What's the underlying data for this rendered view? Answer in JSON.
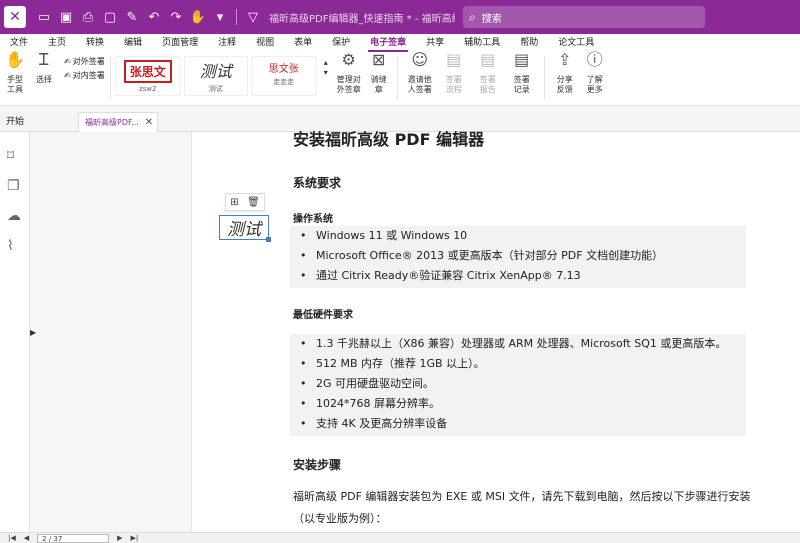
{
  "titlebar": {
    "logo": "✕",
    "doc_title": "福昕高级PDF编辑器_快速指南 *  - 福昕高级PDF编...",
    "search_placeholder": "搜索"
  },
  "menu": [
    "文件",
    "主页",
    "转换",
    "编辑",
    "页面管理",
    "注释",
    "视图",
    "表单",
    "保护",
    "电子签章",
    "共享",
    "辅助工具",
    "帮助",
    "论文工具"
  ],
  "menu_active": "电子签章",
  "ribbon": {
    "hand_tool": "手型\n工具",
    "select": "选择",
    "sign_external": "对外签署",
    "sign_internal": "对内签署",
    "signatures": [
      {
        "text": "张思文",
        "label": "zsw2"
      },
      {
        "text": "测试",
        "label": "测试"
      },
      {
        "text": "思文张",
        "label": "走走走"
      }
    ],
    "manage_external": "管理对\n外签章",
    "stamp": "骑缝\n章",
    "invite": "邀请他\n人签署",
    "sign_flow": "签署\n流程",
    "sign_report": "签署\n报告",
    "sign_record": "签署\n记录",
    "share_feedback": "分享\n反馈",
    "learn_more": "了解\n更多"
  },
  "tabs": {
    "start": "开始",
    "doc": "福昕高级PDF..."
  },
  "placed_signature": "测试",
  "document": {
    "title": "安装福昕高级 PDF 编辑器",
    "sys_req": "系统要求",
    "os_heading": "操作系统",
    "os_items": [
      "Windows 11 或 Windows 10",
      "Microsoft Office® 2013 或更高版本（针对部分 PDF 文档创建功能）",
      "通过 Citrix Ready®验证兼容 Citrix XenApp® 7.13"
    ],
    "hw_heading": "最低硬件要求",
    "hw_items": [
      "1.3 千兆赫以上（X86 兼容）处理器或 ARM 处理器、Microsoft SQ1 或更高版本。",
      "512 MB 内存（推荐 1GB 以上）。",
      "2G 可用硬盘驱动空间。",
      "1024*768 屏幕分辨率。",
      "支持 4K 及更高分辨率设备"
    ],
    "install_heading": "安装步骤",
    "install_para": "福昕高级 PDF 编辑器安装包为 EXE 或 MSI 文件，请先下载到电脑，然后按以下步骤进行安装（以专业版为例）："
  },
  "status": {
    "page": "2 / 37"
  }
}
